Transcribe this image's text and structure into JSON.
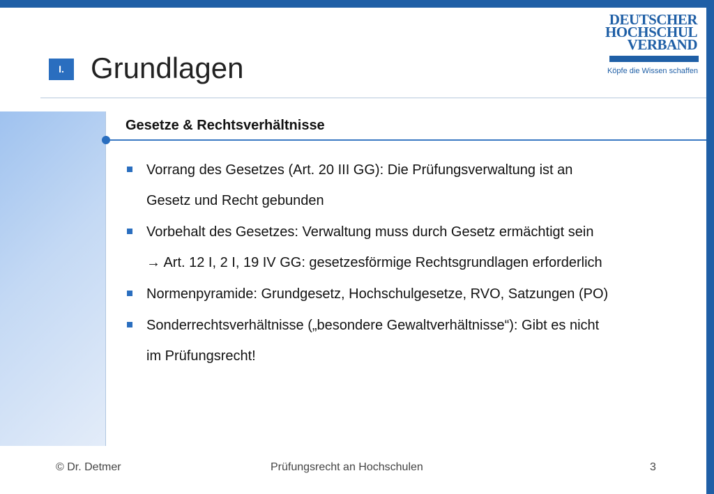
{
  "header": {
    "section_badge": "I.",
    "title": "Grundlagen"
  },
  "logo": {
    "line1": "DEUTSCHER",
    "line2": "HOCHSCHUL",
    "line3": "VERBAND",
    "tagline": "Köpfe die Wissen schaffen"
  },
  "content": {
    "subtitle": "Gesetze & Rechtsverhältnisse",
    "bullets": [
      {
        "lines": [
          "Vorrang des Gesetzes (Art. 20 III GG): Die Prüfungsverwaltung ist an",
          "Gesetz und Recht gebunden"
        ]
      },
      {
        "lines": [
          "Vorbehalt des Gesetzes: Verwaltung muss durch Gesetz ermächtigt sein",
          "→ Art. 12 I, 2 I, 19 IV GG: gesetzesförmige Rechtsgrundlagen erforderlich"
        ]
      },
      {
        "lines": [
          "Normenpyramide: Grundgesetz, Hochschulgesetze, RVO, Satzungen (PO)"
        ]
      },
      {
        "lines": [
          "Sonderrechtsverhältnisse („besondere Gewaltverhältnisse“): Gibt es nicht",
          "im Prüfungsrecht!"
        ]
      }
    ]
  },
  "footer": {
    "author": "© Dr. Detmer",
    "course": "Prüfungsrecht an Hochschulen",
    "page_number": "3"
  },
  "colors": {
    "accent": "#1f5fa6",
    "badge": "#2a6ebf",
    "side_panel": "#9fc2ef"
  }
}
